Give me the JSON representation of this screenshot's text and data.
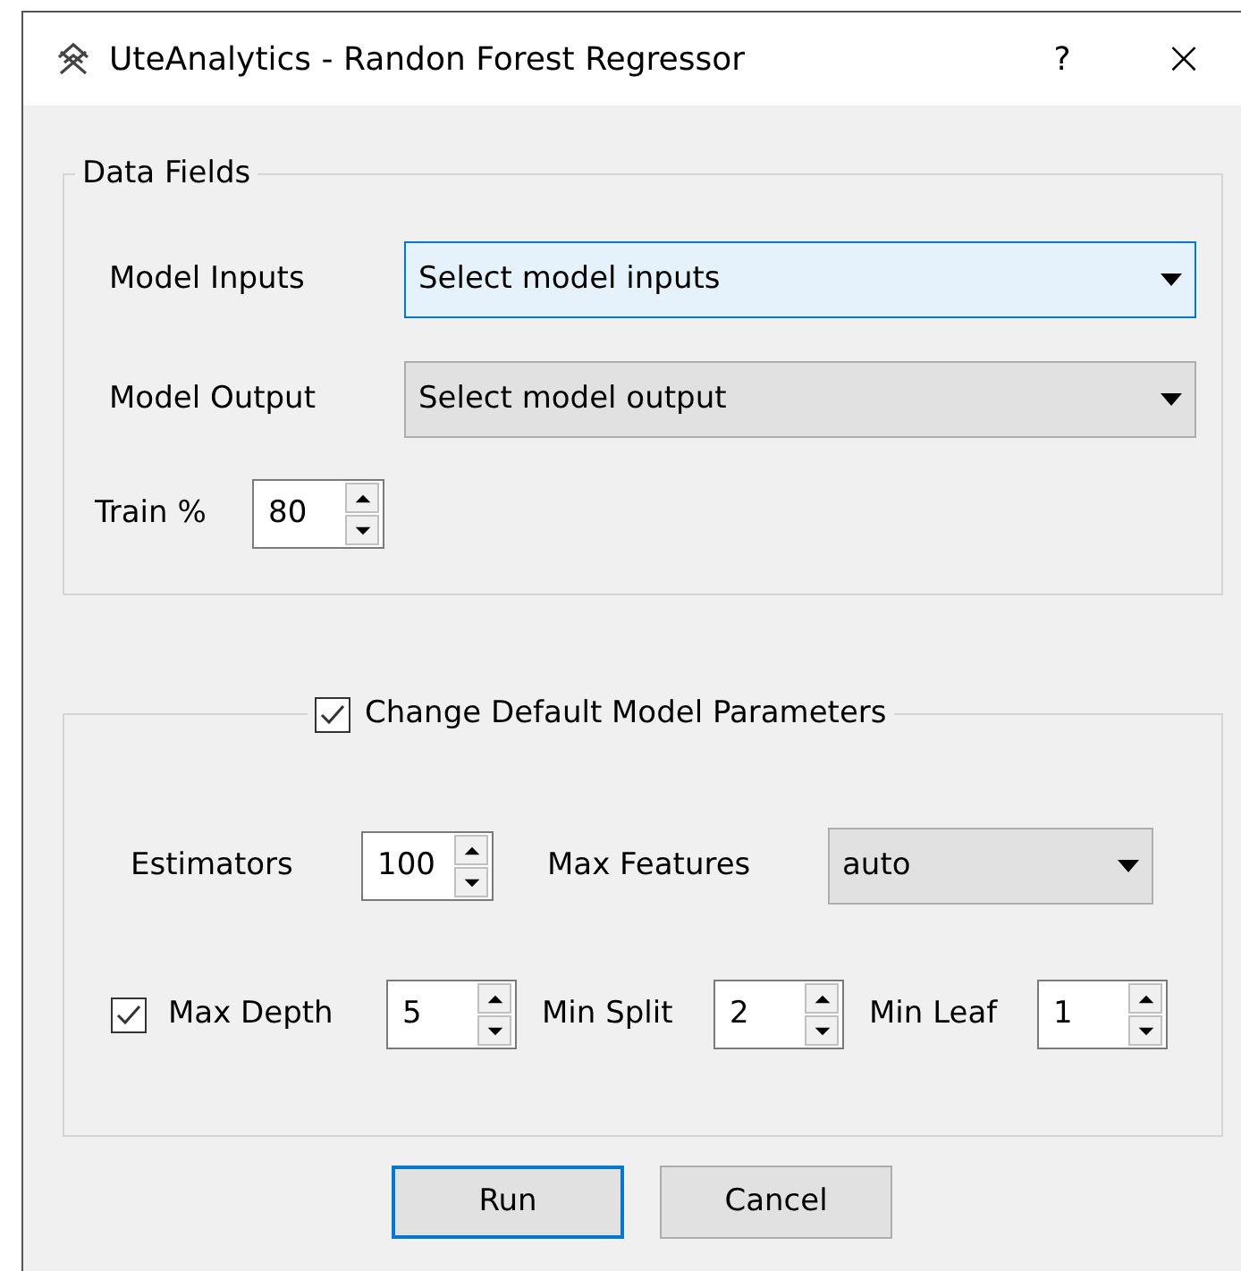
{
  "window": {
    "title": "UteAnalytics - Randon Forest Regressor",
    "help": "?",
    "close": "×"
  },
  "data_fields": {
    "title": "Data Fields",
    "model_inputs": {
      "label": "Model Inputs",
      "value": "Select model inputs",
      "focused": true
    },
    "model_output": {
      "label": "Model Output",
      "value": "Select model output",
      "focused": false
    },
    "train": {
      "label": "Train %",
      "value": "80"
    }
  },
  "parameters": {
    "title": "Change Default Model Parameters",
    "checked": true,
    "estimators": {
      "label": "Estimators",
      "value": "100"
    },
    "max_features": {
      "label": "Max Features",
      "value": "auto"
    },
    "max_depth": {
      "label": "Max Depth",
      "checked": true,
      "value": "5"
    },
    "min_split": {
      "label": "Min Split",
      "value": "2"
    },
    "min_leaf": {
      "label": "Min Leaf",
      "value": "1"
    }
  },
  "buttons": [
    {
      "label": "Run",
      "focused": true
    },
    {
      "label": "Cancel",
      "focused": false
    }
  ]
}
